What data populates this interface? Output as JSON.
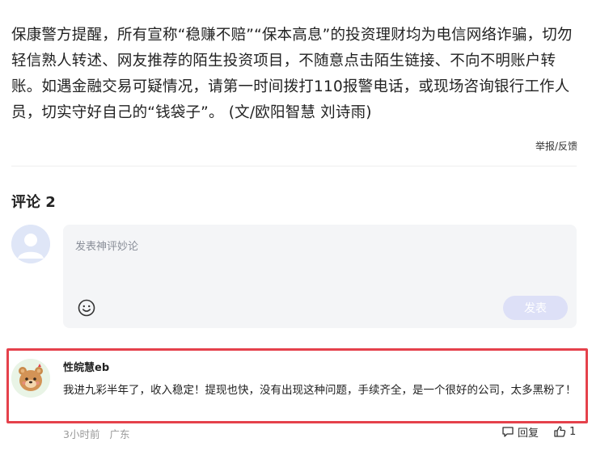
{
  "article": {
    "paragraph": "保康警方提醒，所有宣称“稳赚不赔”“保本高息”的投资理财均为电信网络诈骗，切勿轻信熟人转述、网友推荐的陌生投资项目，不随意点击陌生链接、不向不明账户转账。如遇金融交易可疑情况，请第一时间拨打110报警电话，或现场咨询银行工作人员，切实守好自己的“钱袋子”。 (文/欧阳智慧 刘诗雨)",
    "report_label": "举报/反馈"
  },
  "comments": {
    "title": "评论 2",
    "input": {
      "placeholder": "发表神评妙论",
      "emoji_icon": "smiley-icon",
      "submit_label": "发表"
    },
    "items": [
      {
        "avatar_icon": "bear-avatar",
        "username": "性皖慧eb",
        "text": "我进九彩半年了，收入稳定！提现也快，没有出现这种问题，手续齐全，是一个很好的公司，太多黑粉了！",
        "time": "3小时前",
        "location": "广东",
        "reply_label": "回复",
        "like_count": "1"
      }
    ]
  },
  "colors": {
    "highlight_border": "#e5414b",
    "submit_disabled_bg": "#dde0f7",
    "input_bg": "#f4f5f7",
    "meta_text": "#999999"
  }
}
